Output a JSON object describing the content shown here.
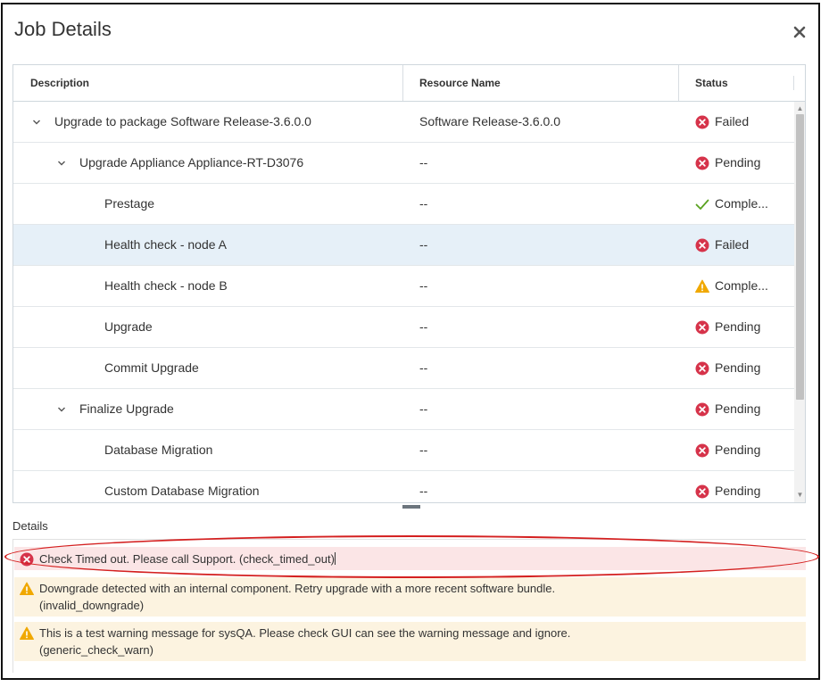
{
  "dialog": {
    "title": "Job Details",
    "close_glyph": "✕"
  },
  "grid": {
    "columns": [
      "Description",
      "Resource Name",
      "Status"
    ],
    "rows": [
      {
        "indent": 0,
        "expander": "chevron-down",
        "description": "Upgrade to package Software Release-3.6.0.0",
        "resource": "Software Release-3.6.0.0",
        "status": "Failed",
        "status_icon": "error-icon",
        "selected": false
      },
      {
        "indent": 1,
        "expander": "chevron-down",
        "description": "Upgrade Appliance Appliance-RT-D3076",
        "resource": "--",
        "status": "Pending",
        "status_icon": "error-icon",
        "selected": false
      },
      {
        "indent": 2,
        "expander": "",
        "description": "Prestage",
        "resource": "--",
        "status": "Comple...",
        "status_icon": "check-icon",
        "selected": false
      },
      {
        "indent": 2,
        "expander": "",
        "description": "Health check - node A",
        "resource": "--",
        "status": "Failed",
        "status_icon": "error-icon",
        "selected": true
      },
      {
        "indent": 2,
        "expander": "",
        "description": "Health check - node B",
        "resource": "--",
        "status": "Comple...",
        "status_icon": "warning-icon",
        "selected": false
      },
      {
        "indent": 2,
        "expander": "",
        "description": "Upgrade",
        "resource": "--",
        "status": "Pending",
        "status_icon": "error-icon",
        "selected": false
      },
      {
        "indent": 2,
        "expander": "",
        "description": "Commit Upgrade",
        "resource": "--",
        "status": "Pending",
        "status_icon": "error-icon",
        "selected": false
      },
      {
        "indent": 1,
        "expander": "chevron-down",
        "description": "Finalize Upgrade",
        "resource": "--",
        "status": "Pending",
        "status_icon": "error-icon",
        "selected": false
      },
      {
        "indent": 2,
        "expander": "",
        "description": "Database Migration",
        "resource": "--",
        "status": "Pending",
        "status_icon": "error-icon",
        "selected": false
      },
      {
        "indent": 2,
        "expander": "",
        "description": "Custom Database Migration",
        "resource": "--",
        "status": "Pending",
        "status_icon": "error-icon",
        "selected": false
      }
    ]
  },
  "details": {
    "label": "Details",
    "messages": [
      {
        "type": "error",
        "icon": "error-icon",
        "lines": [
          "Check Timed out. Please call Support. (check_timed_out)"
        ]
      },
      {
        "type": "warning",
        "icon": "warning-icon",
        "lines": [
          "Downgrade detected with an internal component. Retry upgrade with a more recent software bundle.",
          "(invalid_downgrade)"
        ]
      },
      {
        "type": "warning",
        "icon": "warning-icon",
        "lines": [
          "This is a test warning message for sysQA. Please check GUI can see the warning message and ignore.",
          "(generic_check_warn)"
        ]
      }
    ]
  },
  "colors": {
    "error": "#d6334a",
    "warning": "#f0a800",
    "success": "#5aa220",
    "selected_row": "#e6f0f8",
    "annotation": "#d42020"
  }
}
